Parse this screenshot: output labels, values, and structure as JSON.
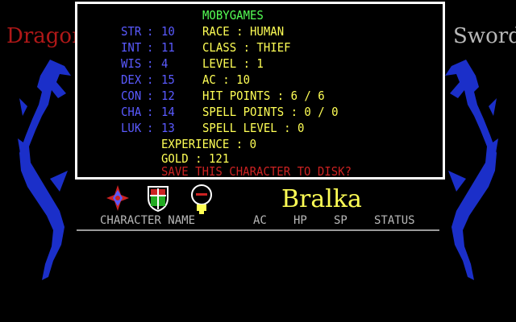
{
  "side_titles": {
    "left": "Dragon",
    "right": "Sword"
  },
  "panel": {
    "header": "MOBYGAMES",
    "stats": [
      {
        "name": "STR",
        "value": "10"
      },
      {
        "name": "INT",
        "value": "11"
      },
      {
        "name": "WIS",
        "value": "4"
      },
      {
        "name": "DEX",
        "value": "15"
      },
      {
        "name": "CON",
        "value": "12"
      },
      {
        "name": "CHA",
        "value": "14"
      },
      {
        "name": "LUK",
        "value": "13"
      }
    ],
    "info": [
      "RACE : HUMAN",
      "CLASS : THIEF",
      "LEVEL : 1",
      "AC : 10",
      "HIT POINTS : 6 / 6",
      "SPELL POINTS : 0 / 0",
      "SPELL LEVEL : 0"
    ],
    "experience": "EXPERIENCE : 0",
    "gold": "GOLD : 121",
    "prompt": "SAVE THIS CHARACTER TO DISK?"
  },
  "icons": [
    "compass-icon",
    "shield-icon",
    "lamp-icon"
  ],
  "character_name": "Bralka",
  "party_header": {
    "character_name": "CHARACTER NAME",
    "ac": "AC",
    "hp": "HP",
    "sp": "SP",
    "status": "STATUS"
  },
  "colors": {
    "stat_blue": "#5a5aff",
    "info_yellow": "#ffff55",
    "header_green": "#55ff55",
    "prompt_red": "#cc2222",
    "dragon_blue": "#1b2fc9"
  }
}
